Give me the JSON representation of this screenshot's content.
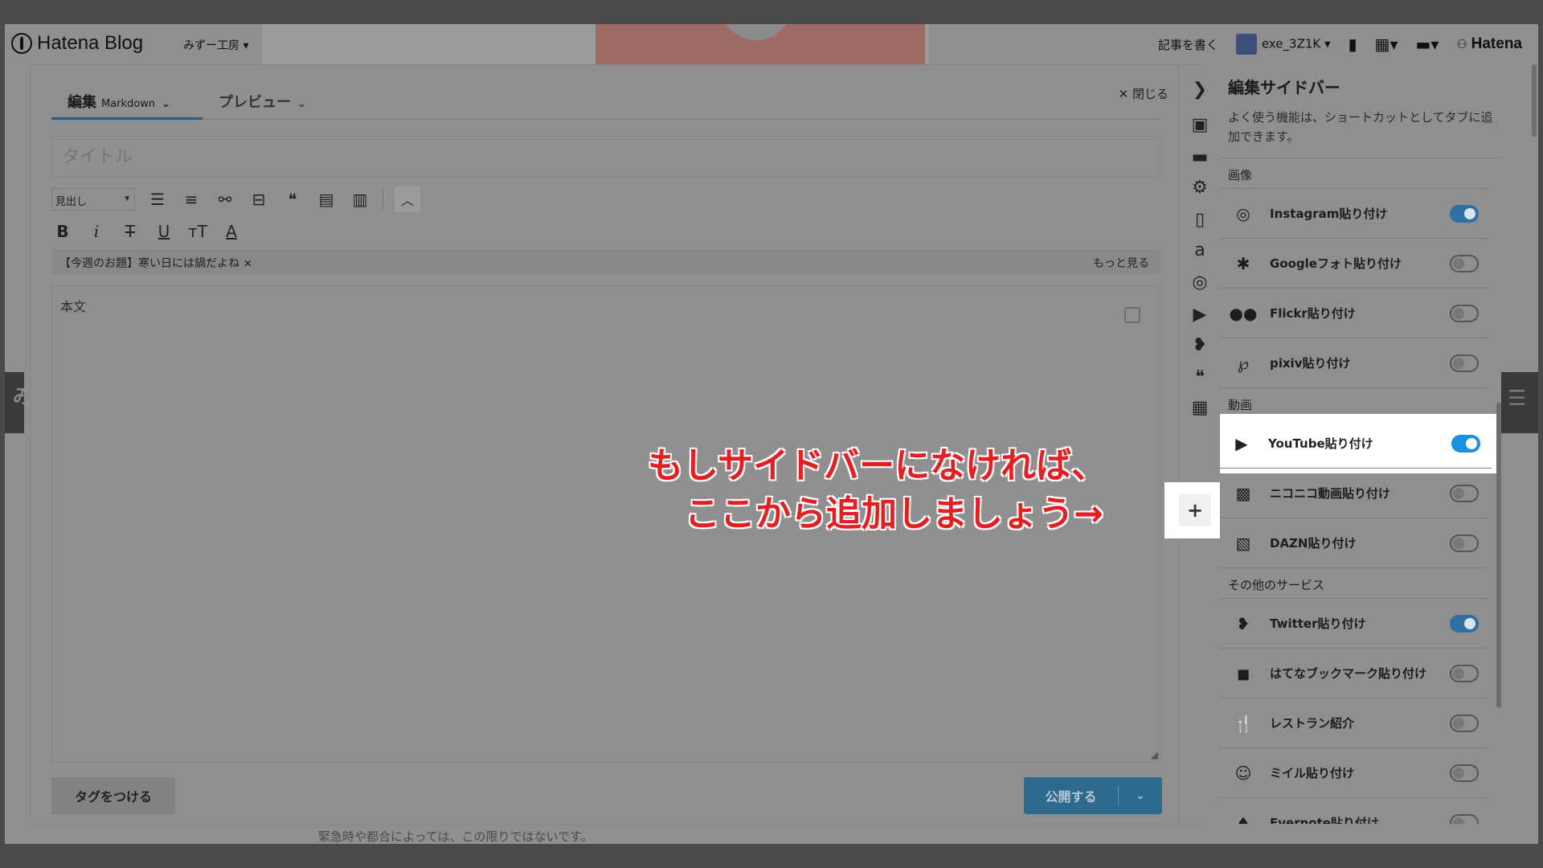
{
  "header": {
    "logo": "Hatena Blog",
    "blog_name": "みずー工房 ▾",
    "write_link": "記事を書く",
    "user": "exe_3Z1K ▾",
    "brand": "Hatena"
  },
  "editor": {
    "tab_edit": "編集",
    "tab_edit_mode": "Markdown",
    "tab_preview": "プレビュー",
    "close": "閉じる",
    "title_placeholder": "タイトル",
    "heading_select": "見出し",
    "topic": "【今週のお題】寒い日には鍋だよね ×",
    "topic_more": "もっと見る",
    "body_placeholder": "本文",
    "tag_button": "タグをつける",
    "publish_button": "公開する"
  },
  "sidebar": {
    "title": "編集サイドバー",
    "description": "よく使う機能は、ショートカットとしてタブに追加できます。",
    "sections": [
      {
        "label": "画像"
      },
      {
        "label": "動画"
      },
      {
        "label": "その他のサービス"
      }
    ],
    "items": [
      {
        "label": "Instagram貼り付け",
        "icon": "instagram-icon",
        "on": true
      },
      {
        "label": "Googleフォト貼り付け",
        "icon": "google-photos-icon",
        "on": false
      },
      {
        "label": "Flickr貼り付け",
        "icon": "flickr-icon",
        "on": false
      },
      {
        "label": "pixiv貼り付け",
        "icon": "pixiv-icon",
        "on": false
      },
      {
        "label": "YouTube貼り付け",
        "icon": "youtube-icon",
        "on": true
      },
      {
        "label": "ニコニコ動画貼り付け",
        "icon": "niconico-icon",
        "on": false
      },
      {
        "label": "DAZN貼り付け",
        "icon": "dazn-icon",
        "on": false
      },
      {
        "label": "Twitter貼り付け",
        "icon": "twitter-icon",
        "on": true
      },
      {
        "label": "はてなブックマーク貼り付け",
        "icon": "hatena-bookmark-icon",
        "on": false
      },
      {
        "label": "レストラン紹介",
        "icon": "restaurant-icon",
        "on": false
      },
      {
        "label": "ミイル貼り付け",
        "icon": "miil-icon",
        "on": false
      },
      {
        "label": "Evernote貼り付け",
        "icon": "evernote-icon",
        "on": false
      }
    ]
  },
  "annotation": {
    "line1": "もしサイドバーになければ、",
    "line2": "ここから追加しましょう→"
  },
  "footnote": "緊急時や都合によっては、この限りではないです。",
  "colors": {
    "accent": "#1d8fe0",
    "annotation": "#e31f22",
    "publish": "#2e6a8e"
  }
}
